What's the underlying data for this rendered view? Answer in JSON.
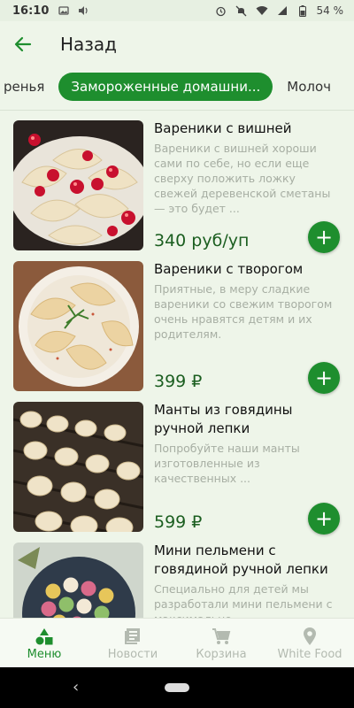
{
  "status": {
    "time": "16:10",
    "battery": "54 %"
  },
  "header": {
    "title": "Назад"
  },
  "categories": {
    "prev": "ренья",
    "active": "Замороженные домашни...",
    "next": "Молоч"
  },
  "products": [
    {
      "title": "Вареники с вишней",
      "description": "Вареники с вишней хороши сами по себе, но если еще сверху положить ложку свежей деревенской сметаны — это будет ...",
      "price": "340 руб/уп"
    },
    {
      "title": "Вареники с творогом",
      "description": "Приятные, в меру сладкие вареники со свежим творогом очень нравятся детям и их родителям.",
      "price": "399 ₽"
    },
    {
      "title": "Манты из говядины ручной лепки",
      "description": "Попробуйте наши манты изготовленные из качественных ...",
      "price": "599 ₽"
    },
    {
      "title": "Мини пельмени с говядиной ручной лепки",
      "description": "Специально для детей мы разработали мини пельмени с максимально",
      "price": ""
    }
  ],
  "nav": [
    {
      "label": "Меню",
      "icon": "shapes-icon"
    },
    {
      "label": "Новости",
      "icon": "news-icon"
    },
    {
      "label": "Корзина",
      "icon": "cart-icon"
    },
    {
      "label": "White Food",
      "icon": "location-icon"
    }
  ],
  "colors": {
    "accent": "#1e8e2e",
    "background": "#eef5e9",
    "price": "#1b5e20"
  }
}
